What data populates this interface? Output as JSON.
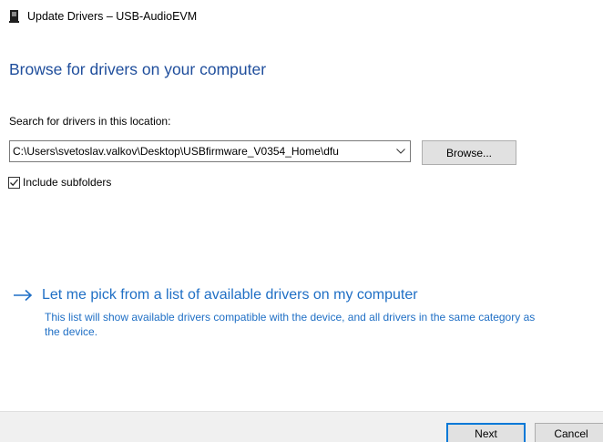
{
  "window": {
    "title": "Update Drivers – USB-AudioEVM",
    "icon": "device-manager-icon"
  },
  "main": {
    "heading": "Browse for drivers on your computer",
    "location_label": "Search for drivers in this location:",
    "path_value": "C:\\Users\\svetoslav.valkov\\Desktop\\USBfirmware_V0354_Home\\dfu",
    "browse_label": "Browse...",
    "include_subfolders": {
      "label": "Include subfolders",
      "checked": true
    },
    "pick_link": {
      "title": "Let me pick from a list of available drivers on my computer",
      "description": "This list will show available drivers compatible with the device, and all drivers in the same category as the device."
    }
  },
  "footer": {
    "next_label": "Next",
    "cancel_label": "Cancel"
  },
  "colors": {
    "heading": "#1f4e9c",
    "link": "#1f6fc5",
    "button_focus": "#0078d7",
    "footer_bg": "#f0f0f0"
  }
}
